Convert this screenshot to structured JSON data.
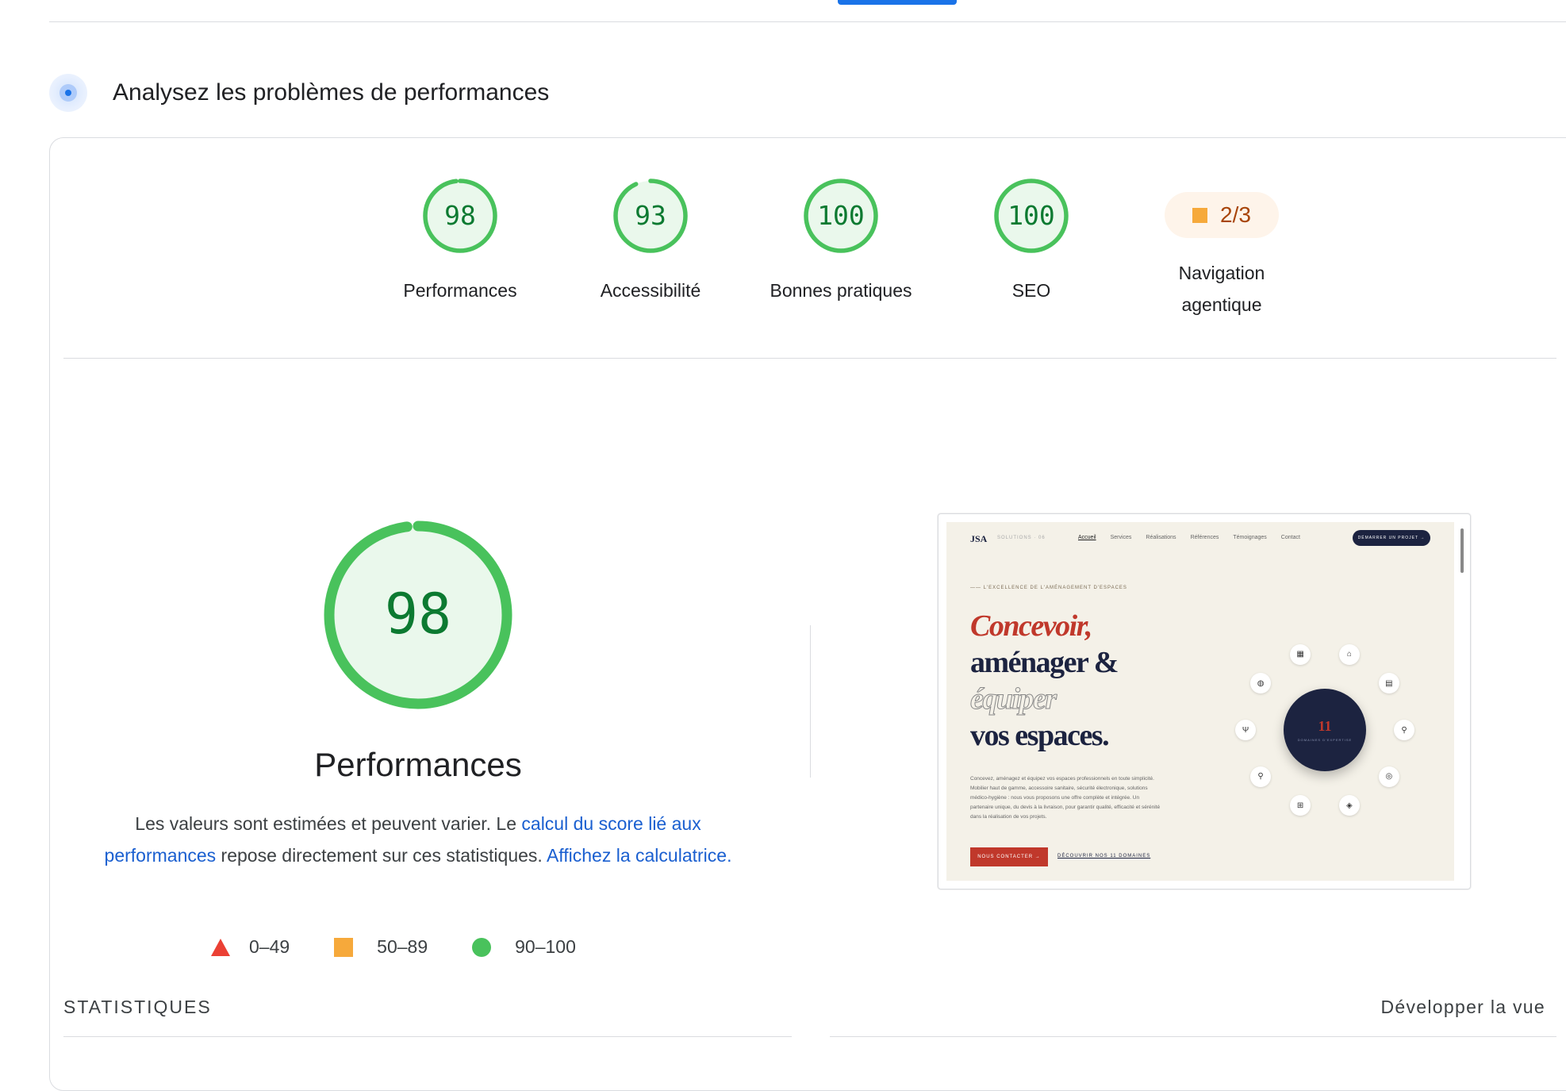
{
  "section": {
    "title": "Analysez les problèmes de performances",
    "icon": "analyze-icon"
  },
  "gauges": [
    {
      "name": "performances",
      "value": "98",
      "score": 98,
      "label": "Performances",
      "color": "#0c7a31"
    },
    {
      "name": "accessibilite",
      "value": "93",
      "score": 93,
      "label": "Accessibilité",
      "color": "#0c7a31"
    },
    {
      "name": "bonnes-pratiques",
      "value": "100",
      "score": 100,
      "label": "Bonnes pratiques",
      "color": "#0c7a31"
    },
    {
      "name": "seo",
      "value": "100",
      "score": 100,
      "label": "SEO",
      "color": "#0c7a31"
    }
  ],
  "agentic": {
    "value": "2/3",
    "label_line1": "Navigation",
    "label_line2": "agentique",
    "color": "#a8450a"
  },
  "main": {
    "score": "98",
    "score_value": 98,
    "title": "Performances",
    "desc_part1": "Les valeurs sont estimées et peuvent varier. Le ",
    "desc_link1": "calcul du score lié aux performances",
    "desc_part2": " repose directement sur ces statistiques. ",
    "desc_link2": "Affichez la calculatrice."
  },
  "legend": [
    {
      "shape": "triangle",
      "range": "0–49",
      "color": "#eb4034"
    },
    {
      "shape": "square",
      "range": "50–89",
      "color": "#f6a93b"
    },
    {
      "shape": "circle",
      "range": "90–100",
      "color": "#49c25c"
    }
  ],
  "stats": {
    "label": "STATISTIQUES",
    "expand": "Développer la vue"
  },
  "colors": {
    "good": "#49c25c",
    "good_fill": "#eaf8ec",
    "good_text": "#0c7a31",
    "accent": "#1a73e8"
  },
  "thumbnail": {
    "logo": "JSA",
    "logo_sub": "SOLUTIONS · 06",
    "menu": [
      "Accueil",
      "Services",
      "Réalisations",
      "Références",
      "Témoignages",
      "Contact"
    ],
    "cta": "DÉMARRER UN PROJET →",
    "eyebrow": "—— L'EXCELLENCE DE L'AMÉNAGEMENT D'ESPACES",
    "h1_line1": "Concevoir,",
    "h1_line2": "aménager &",
    "h1_line3": "équiper",
    "h1_line4": "vos espaces.",
    "body": "Concevez, aménagez et équipez vos espaces professionnels en toute simplicité. Mobilier haut de gamme, accessoire sanitaire, sécurité électronique, solutions médico-hygiène : nous vous proposons une offre complète et intégrée. Un partenaire unique, du devis à la livraison, pour garantir qualité, efficacité et sérénité dans la réalisation de vos projets.",
    "btn1": "NOUS CONTACTER →",
    "btn2": "DÉCOUVRIR NOS 11 DOMAINES",
    "center_number": "11",
    "center_sub": "DOMAINES D'EXPERTISE"
  }
}
